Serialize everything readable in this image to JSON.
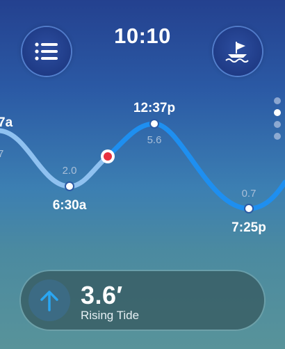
{
  "header": {
    "time": "10:10",
    "menu_icon": "list-icon",
    "boat_icon": "sailboat-icon"
  },
  "tide_chart": {
    "points": [
      {
        "time": "7a",
        "height": "7",
        "kind": "high"
      },
      {
        "time": "6:30a",
        "height": "2.0",
        "kind": "low"
      },
      {
        "time": "12:37p",
        "height": "5.6",
        "kind": "high"
      },
      {
        "time": "7:25p",
        "height": "0.7",
        "kind": "low"
      }
    ],
    "current_marker": {
      "height": 3.6,
      "color": "#e8313f"
    },
    "colors": {
      "past": "#8fc1f0",
      "future": "#1e8ff0"
    }
  },
  "page_indicator": {
    "count": 4,
    "active_index": 1
  },
  "status": {
    "height": "3.6′",
    "label": "Rising Tide",
    "arrow_icon": "arrow-up-icon",
    "arrow_color": "#2aa6f2"
  }
}
